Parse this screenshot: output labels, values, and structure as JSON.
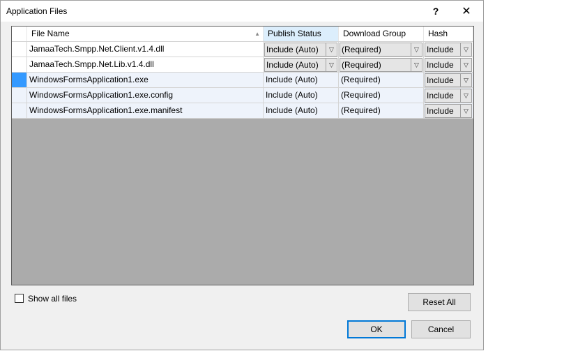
{
  "window": {
    "title": "Application Files",
    "help_glyph": "?",
    "close_glyph": "✕"
  },
  "grid": {
    "columns": [
      {
        "label": "File Name"
      },
      {
        "label": "Publish Status"
      },
      {
        "label": "Download Group"
      },
      {
        "label": "Hash"
      }
    ],
    "rows": [
      {
        "file": "JamaaTech.Smpp.Net.Client.v1.4.dll",
        "status": "Include (Auto)",
        "group": "(Required)",
        "hash": "Include"
      },
      {
        "file": "JamaaTech.Smpp.Net.Lib.v1.4.dll",
        "status": "Include (Auto)",
        "group": "(Required)",
        "hash": "Include"
      },
      {
        "file": "WindowsFormsApplication1.exe",
        "status": "Include (Auto)",
        "group": "(Required)",
        "hash": "Include"
      },
      {
        "file": "WindowsFormsApplication1.exe.config",
        "status": "Include (Auto)",
        "group": "(Required)",
        "hash": "Include"
      },
      {
        "file": "WindowsFormsApplication1.exe.manifest",
        "status": "Include (Auto)",
        "group": "(Required)",
        "hash": "Include"
      }
    ]
  },
  "options": {
    "show_all_files": "Show all files"
  },
  "buttons": {
    "reset_all": "Reset All",
    "ok": "OK",
    "cancel": "Cancel"
  },
  "colors": {
    "selection": "#3399ff",
    "accent": "#0078d7"
  }
}
